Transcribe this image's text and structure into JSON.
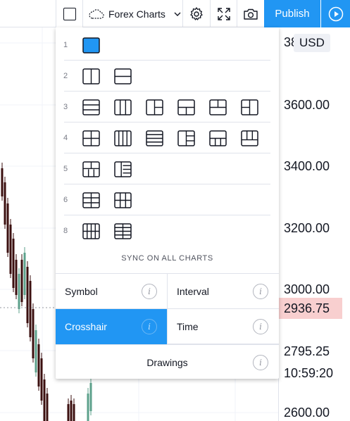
{
  "toolbar": {
    "chart_name": "Forex Charts",
    "publish_label": "Publish"
  },
  "price_axis": {
    "currency": "USD",
    "ticks": [
      "3800.00",
      "3600.00",
      "3400.00",
      "3200.00",
      "3000.00",
      "2795.25",
      "10:59:20",
      "2600.00"
    ],
    "crosshair_price": "2936.75"
  },
  "layout_menu": {
    "rows": [
      {
        "count": "1",
        "options": [
          "single"
        ],
        "selected": 0
      },
      {
        "count": "2",
        "options": [
          "2-vertical",
          "2-horizontal"
        ],
        "selected": -1
      },
      {
        "count": "3",
        "options": [
          "3-rows",
          "3-columns",
          "1-left-2-right",
          "1-top-2-bottom",
          "2-top-1-bottom",
          "2-left-1-right"
        ],
        "selected": -1
      },
      {
        "count": "4",
        "options": [
          "2x2",
          "4-columns",
          "4-rows",
          "1-left-3-right",
          "1-top-3-bottom",
          "3-top-1-bottom"
        ],
        "selected": -1
      },
      {
        "count": "5",
        "options": [
          "2-top-3-bottom",
          "1-left-4-right"
        ],
        "selected": -1
      },
      {
        "count": "6",
        "options": [
          "3x2",
          "2x3"
        ],
        "selected": -1
      },
      {
        "count": "8",
        "options": [
          "4x2",
          "2x4"
        ],
        "selected": -1
      }
    ],
    "sync_title": "SYNC ON ALL CHARTS",
    "sync_options": {
      "symbol": "Symbol",
      "interval": "Interval",
      "crosshair": "Crosshair",
      "time": "Time",
      "drawings": "Drawings"
    },
    "active_sync": "Crosshair",
    "info_glyph": "i"
  },
  "colors": {
    "accent": "#2196f3",
    "candle_down": "#3b0f0f",
    "candle_up": "#5ca18b",
    "crosshair_label": "#f8cfcf"
  }
}
